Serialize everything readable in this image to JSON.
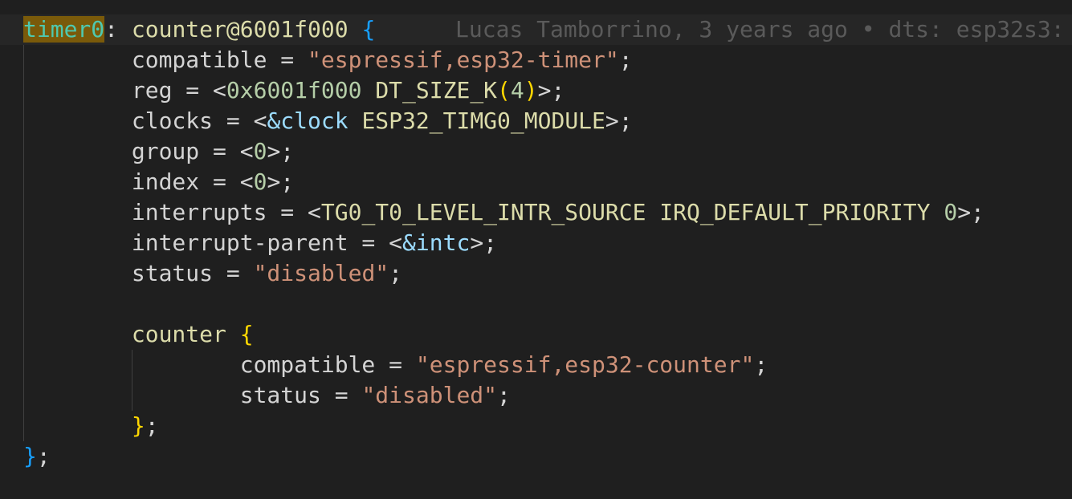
{
  "editor": {
    "blame": "Lucas Tamborrino, 3 years ago • dts: esp32s3: ",
    "l1": {
      "label": "timer0",
      "colon": ": ",
      "node": "counter@6001f000 ",
      "brace": "{"
    },
    "l2": {
      "indent": "        ",
      "prop": "compatible = ",
      "str": "\"espressif,esp32-timer\"",
      "end": ";"
    },
    "l3": {
      "indent": "        ",
      "prop": "reg = <",
      "num": "0x6001f000",
      "sp": " ",
      "macro": "DT_SIZE_K",
      "p1": "(",
      "num2": "4",
      "p2": ")",
      "end": ">;"
    },
    "l4": {
      "indent": "        ",
      "prop": "clocks = <",
      "ref": "&clock",
      "sp": " ",
      "macro": "ESP32_TIMG0_MODULE",
      "end": ">;"
    },
    "l5": {
      "indent": "        ",
      "prop": "group = <",
      "num": "0",
      "end": ">;"
    },
    "l6": {
      "indent": "        ",
      "prop": "index = <",
      "num": "0",
      "end": ">;"
    },
    "l7": {
      "indent": "        ",
      "prop": "interrupts = <",
      "macro": "TG0_T0_LEVEL_INTR_SOURCE IRQ_DEFAULT_PRIORITY",
      "sp": " ",
      "num": "0",
      "end": ">;"
    },
    "l8": {
      "indent": "        ",
      "prop": "interrupt-parent = <",
      "ref": "&intc",
      "end": ">;"
    },
    "l9": {
      "indent": "        ",
      "prop": "status = ",
      "str": "\"disabled\"",
      "end": ";"
    },
    "l11": {
      "indent": "        ",
      "node": "counter ",
      "brace": "{"
    },
    "l12": {
      "indent": "                ",
      "prop": "compatible = ",
      "str": "\"espressif,esp32-counter\"",
      "end": ";"
    },
    "l13": {
      "indent": "                ",
      "prop": "status = ",
      "str": "\"disabled\"",
      "end": ";"
    },
    "l14": {
      "indent": "        ",
      "brace": "}",
      "end": ";"
    },
    "l15": {
      "brace": "}",
      "end": ";"
    }
  }
}
